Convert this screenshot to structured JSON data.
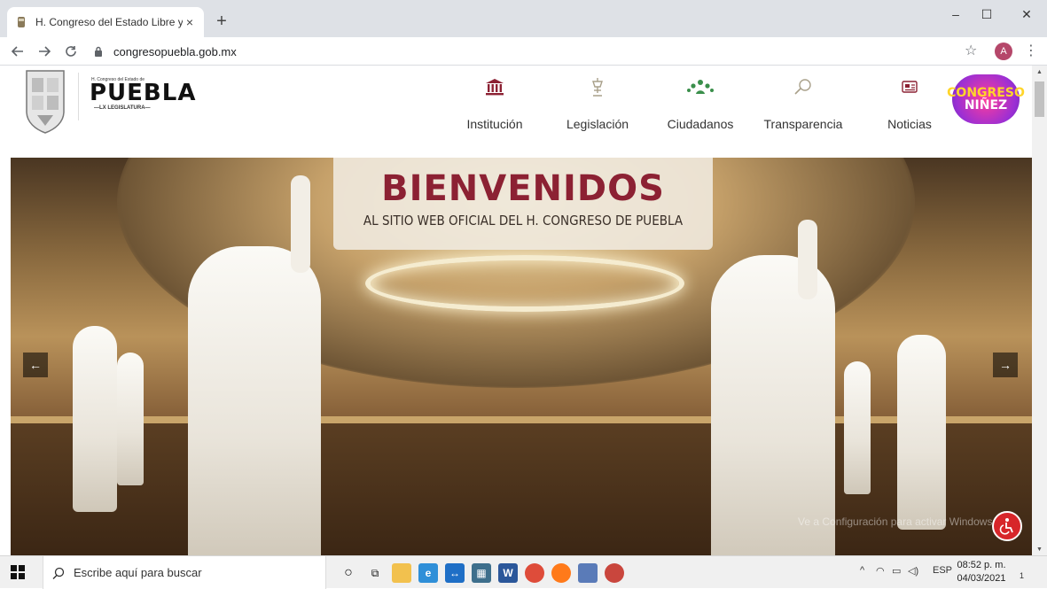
{
  "browser": {
    "tab_title": "H. Congreso del Estado Libre y S",
    "tab_close": "×",
    "new_tab": "+",
    "url": "congresopuebla.gob.mx",
    "avatar_letter": "A",
    "window_controls": {
      "minimize": "–",
      "maximize": "☐",
      "close": "✕"
    }
  },
  "site": {
    "logo": {
      "top_text": "H. Congreso del Estado de",
      "main_text": "PUEBLA",
      "sub_text": "—LX LEGISLATURA—"
    },
    "nav": [
      {
        "label": "Institución",
        "icon": "building-columns-icon"
      },
      {
        "label": "Legislación",
        "icon": "lamp-icon"
      },
      {
        "label": "Ciudadanos",
        "icon": "people-group-icon"
      },
      {
        "label": "Transparencia",
        "icon": "magnifier-icon"
      },
      {
        "label": "Noticias",
        "icon": "newspaper-icon"
      }
    ],
    "promo_badge": {
      "line1": "CONGRESO",
      "line2": "NIÑEZ"
    },
    "hero": {
      "title": "BIENVENIDOS",
      "subtitle": "AL SITIO WEB OFICIAL DEL H. CONGRESO DE PUEBLA",
      "prev_label": "←",
      "next_label": "→",
      "watermark": "Ve a Configuración para activar Windows."
    }
  },
  "taskbar": {
    "search_placeholder": "Escribe aquí para buscar",
    "language": "ESP",
    "time": "08:52 p. m.",
    "date": "04/03/2021",
    "notifications": "1"
  },
  "colors": {
    "brand_red": "#8c2133",
    "accent_gold": "#c9a56a",
    "access_red": "#d7262a"
  }
}
